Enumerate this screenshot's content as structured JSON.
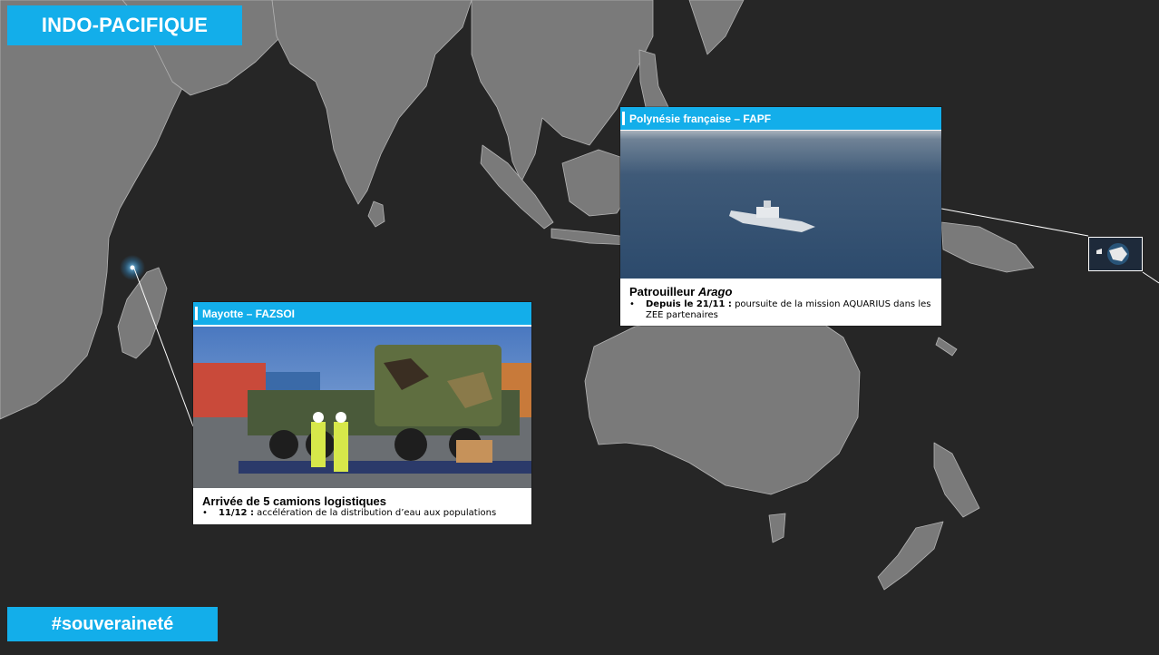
{
  "title": "INDO-PACIFIQUE",
  "hashtag": "#souveraineté",
  "colors": {
    "accent": "#13aeea",
    "background": "#262626",
    "land": "#7a7a7a"
  },
  "cards": {
    "mayotte": {
      "header": "Mayotte – FAZSOI",
      "title": "Arrivée de 5 camions logistiques",
      "bullet_bold": "11/12 :",
      "bullet_text": " accélération de la distribution d’eau aux populations",
      "photo": "military-trucks-on-flatbed-photo"
    },
    "polynesie": {
      "header": "Polynésie française – FAPF",
      "title_prefix": "Patrouilleur ",
      "title_italic": "Arago",
      "bullet_bold": "Depuis le 21/11 :",
      "bullet_text": " poursuite de la mission AQUARIUS dans les ZEE partenaires",
      "photo": "patrol-ship-at-sea-photo"
    }
  },
  "bullet_glyph": "•"
}
